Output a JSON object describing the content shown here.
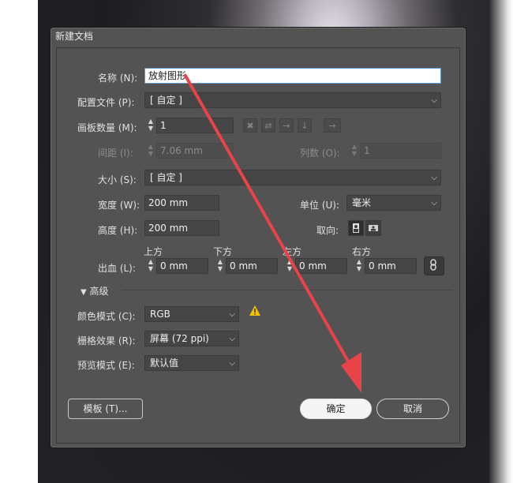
{
  "dialog": {
    "title": "新建文档",
    "name_label": "名称 (N):",
    "name_value": "放射图形",
    "profile_label": "配置文件 (P):",
    "profile_value": "[ 自定 ]",
    "artboards_label": "画板数量 (M):",
    "artboards_value": "1",
    "spacing_label": "间距 (I):",
    "spacing_value": "7.06 mm",
    "columns_label": "列数 (O):",
    "columns_value": "1",
    "size_label": "大小 (S):",
    "size_value": "[ 自定 ]",
    "width_label": "宽度 (W):",
    "width_value": "200 mm",
    "units_label": "单位 (U):",
    "units_value": "毫米",
    "height_label": "高度 (H):",
    "height_value": "200 mm",
    "orientation_label": "取向:",
    "bleed_label": "出血 (L):",
    "bleed_top_label": "上方",
    "bleed_top_value": "0 mm",
    "bleed_bottom_label": "下方",
    "bleed_bottom_value": "0 mm",
    "bleed_left_label": "左方",
    "bleed_left_value": "0 mm",
    "bleed_right_label": "右方",
    "bleed_right_value": "0 mm",
    "advanced_label": "高级",
    "color_mode_label": "颜色模式 (C):",
    "color_mode_value": "RGB",
    "raster_label": "栅格效果 (R):",
    "raster_value": "屏幕 (72 ppi)",
    "preview_label": "预览模式 (E):",
    "preview_value": "默认值",
    "template_button": "模板 (T)...",
    "ok_button": "确定",
    "cancel_button": "取消"
  },
  "colors": {
    "dialog_bg": "#535353",
    "annotation_arrow": "#e8434a",
    "warning": "#f2c200"
  },
  "icons": {
    "artboard_layout": [
      "grid-by-row-icon",
      "grid-by-column-icon",
      "arrange-by-row-icon",
      "arrange-by-column-icon",
      "layout-direction-icon"
    ],
    "orientation": [
      "portrait-icon",
      "landscape-icon"
    ],
    "link": "link-bleed-icon",
    "warning": "warning-icon"
  }
}
